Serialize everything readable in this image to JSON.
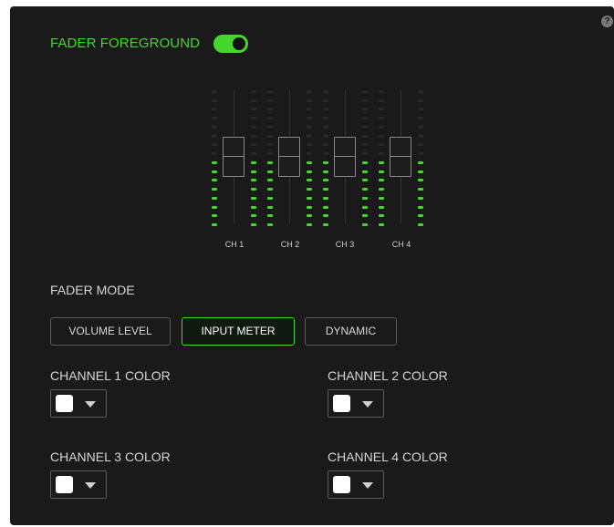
{
  "fader_foreground": {
    "label": "FADER FOREGROUND",
    "enabled": true
  },
  "help": {
    "glyph": "?"
  },
  "mixer": {
    "channels": [
      {
        "label": "CH 1",
        "level_fraction": 0.5
      },
      {
        "label": "CH 2",
        "level_fraction": 0.5
      },
      {
        "label": "CH 3",
        "level_fraction": 0.5
      },
      {
        "label": "CH 4",
        "level_fraction": 0.5
      }
    ],
    "meter_color": "#44d62c"
  },
  "fader_mode": {
    "label": "FADER MODE",
    "options": [
      "VOLUME LEVEL",
      "INPUT METER",
      "DYNAMIC"
    ],
    "selected": "INPUT METER"
  },
  "channel_colors": [
    {
      "label": "CHANNEL 1 COLOR",
      "color": "#ffffff"
    },
    {
      "label": "CHANNEL 2 COLOR",
      "color": "#ffffff"
    },
    {
      "label": "CHANNEL 3 COLOR",
      "color": "#ffffff"
    },
    {
      "label": "CHANNEL 4 COLOR",
      "color": "#ffffff"
    }
  ],
  "accent_color": "#44d62c"
}
